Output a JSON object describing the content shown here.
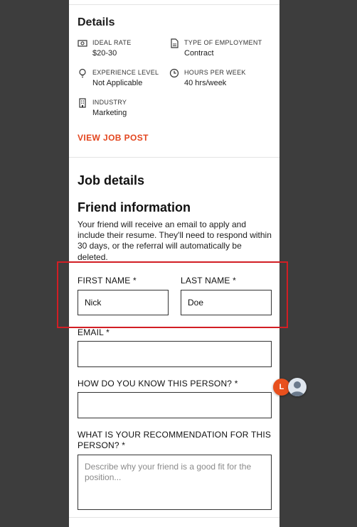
{
  "details": {
    "heading": "Details",
    "items": [
      {
        "label": "IDEAL RATE",
        "value": "$20-30",
        "icon": "money-icon"
      },
      {
        "label": "TYPE OF EMPLOYMENT",
        "value": "Contract",
        "icon": "document-icon"
      },
      {
        "label": "EXPERIENCE LEVEL",
        "value": "Not Applicable",
        "icon": "lightbulb-icon"
      },
      {
        "label": "HOURS PER WEEK",
        "value": "40 hrs/week",
        "icon": "clock-icon"
      },
      {
        "label": "INDUSTRY",
        "value": "Marketing",
        "icon": "building-icon"
      }
    ],
    "view_link": "VIEW JOB POST"
  },
  "job_details": {
    "heading": "Job details"
  },
  "friend": {
    "heading": "Friend information",
    "intro": "Your friend will receive an email to apply and include their resume. They'll need to respond within 30 days, or the referral will automatically be deleted.",
    "first_name": {
      "label": "FIRST NAME *",
      "value": "Nick"
    },
    "last_name": {
      "label": "LAST NAME *",
      "value": "Doe"
    },
    "email": {
      "label": "EMAIL *",
      "value": ""
    },
    "relationship": {
      "label": "HOW DO YOU KNOW THIS PERSON? *",
      "value": ""
    },
    "recommendation": {
      "label": "WHAT IS YOUR RECOMMENDATION FOR THIS PERSON? *",
      "placeholder": "Describe why your friend is a good fit for the position..."
    }
  },
  "overlay": {
    "avatar_letter": "L"
  },
  "colors": {
    "accent": "#e3461f",
    "highlight": "#d21e24",
    "background": "#3d3d3d",
    "avatar": "#e8501d"
  }
}
